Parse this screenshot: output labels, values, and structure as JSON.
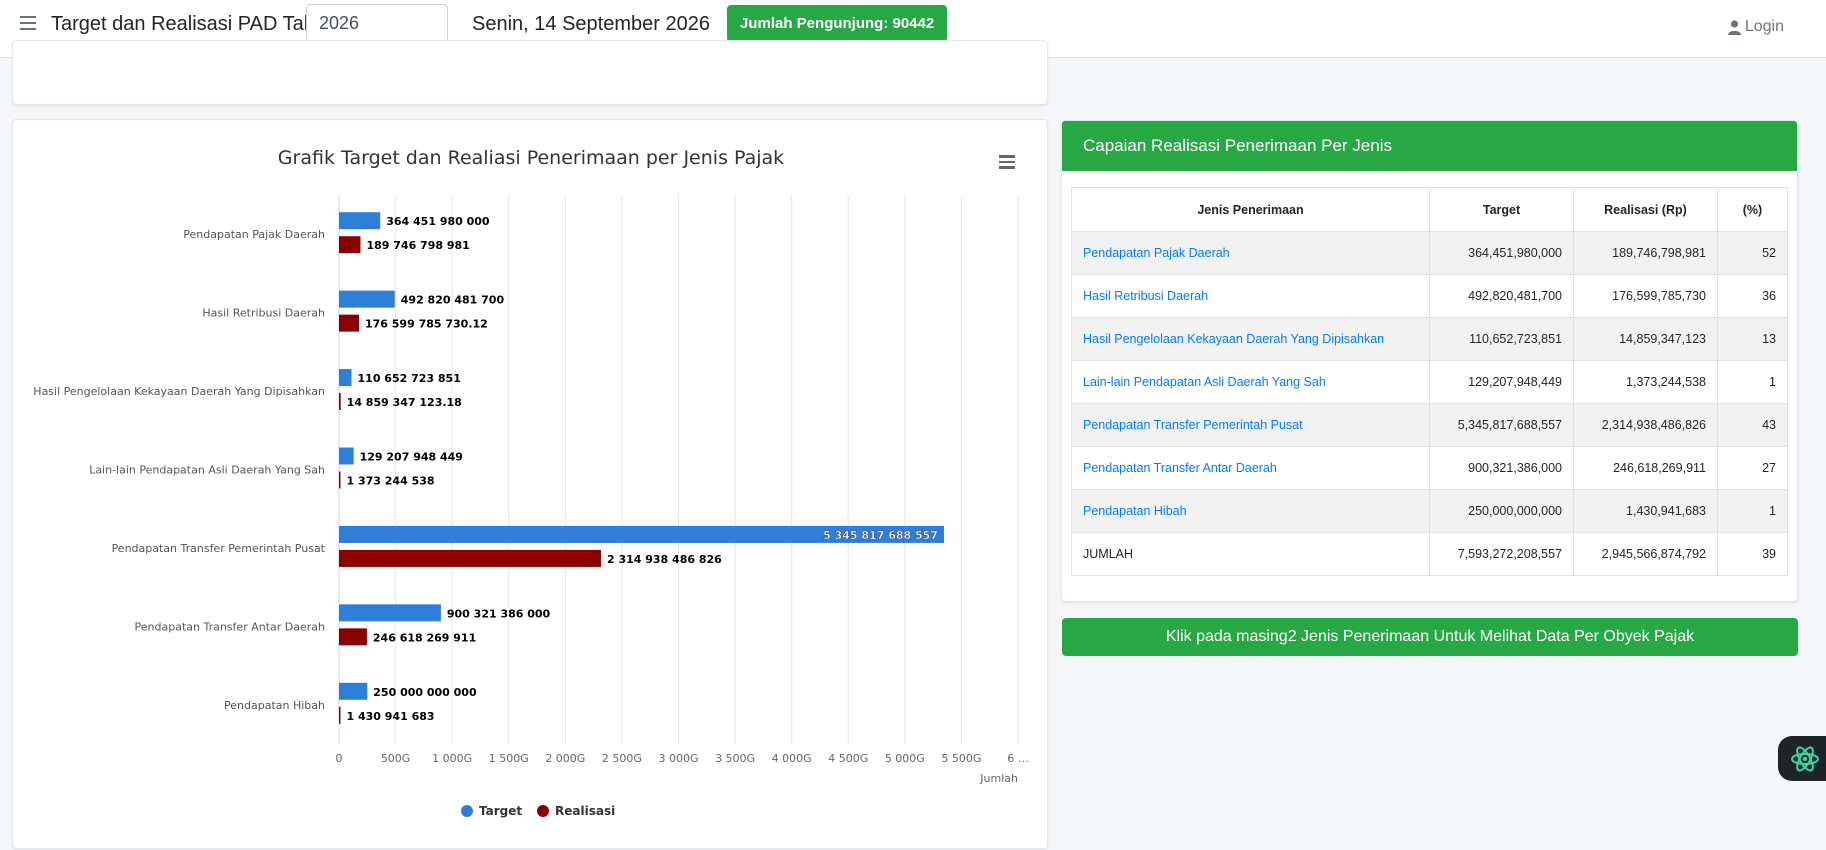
{
  "header": {
    "title": "Target dan Realisasi PAD Tahun",
    "year_value": "2026",
    "date": "Senin, 14 September 2026",
    "visitor_badge": "Jumlah Pengunjung: 90442",
    "login_label": "Login"
  },
  "colors": {
    "accent": "#28a745",
    "target": "#2f7ed8",
    "realisasi": "#8b0000",
    "link": "#007bff"
  },
  "chart_data": {
    "type": "bar",
    "orientation": "horizontal",
    "title": "Grafik Target dan Realiasi Penerimaan per Jenis Pajak",
    "ylabel": "Jumlah",
    "categories": [
      "Pendapatan Pajak Daerah",
      "Hasil Retribusi Daerah",
      "Hasil Pengelolaan Kekayaan Daerah Yang Dipisahkan",
      "Lain-lain Pendapatan Asli Daerah Yang Sah",
      "Pendapatan Transfer Pemerintah Pusat",
      "Pendapatan Transfer Antar Daerah",
      "Pendapatan Hibah"
    ],
    "series": [
      {
        "name": "Target",
        "values": [
          364451980000,
          492820481700,
          110652723851,
          129207948449,
          5345817688557,
          900321386000,
          250000000000
        ],
        "labels": [
          "364 451 980 000",
          "492 820 481 700",
          "110 652 723 851",
          "129 207 948 449",
          "5 345 817 688 557",
          "900 321 386 000",
          "250 000 000 000"
        ]
      },
      {
        "name": "Realisasi",
        "values": [
          189746798981,
          176599785730.12,
          14859347123.18,
          1373244538,
          2314938486826,
          246618269911,
          1430941683
        ],
        "labels": [
          "189 746 798 981",
          "176 599 785 730.12",
          "14 859 347 123.18",
          "1 373 244 538",
          "2 314 938 486 826",
          "246 618 269 911",
          "1 430 941 683"
        ]
      }
    ],
    "axis_ticks": [
      "0",
      "500G",
      "1 000G",
      "1 500G",
      "2 000G",
      "2 500G",
      "3 000G",
      "3 500G",
      "4 000G",
      "4 500G",
      "5 000G",
      "5 500G",
      "6 …"
    ],
    "xlim": [
      0,
      6000000000000
    ],
    "grid": true,
    "legend_position": "bottom-center"
  },
  "table": {
    "title": "Capaian Realisasi Penerimaan Per Jenis",
    "headers": [
      "Jenis Penerimaan",
      "Target",
      "Realisasi (Rp)",
      "(%)"
    ],
    "rows": [
      {
        "name": "Pendapatan Pajak Daerah",
        "target": "364,451,980,000",
        "realisasi": "189,746,798,981",
        "pct": "52"
      },
      {
        "name": "Hasil Retribusi Daerah",
        "target": "492,820,481,700",
        "realisasi": "176,599,785,730",
        "pct": "36"
      },
      {
        "name": "Hasil Pengelolaan Kekayaan Daerah Yang Dipisahkan",
        "target": "110,652,723,851",
        "realisasi": "14,859,347,123",
        "pct": "13"
      },
      {
        "name": "Lain-lain Pendapatan Asli Daerah Yang Sah",
        "target": "129,207,948,449",
        "realisasi": "1,373,244,538",
        "pct": "1"
      },
      {
        "name": "Pendapatan Transfer Pemerintah Pusat",
        "target": "5,345,817,688,557",
        "realisasi": "2,314,938,486,826",
        "pct": "43"
      },
      {
        "name": "Pendapatan Transfer Antar Daerah",
        "target": "900,321,386,000",
        "realisasi": "246,618,269,911",
        "pct": "27"
      },
      {
        "name": "Pendapatan Hibah",
        "target": "250,000,000,000",
        "realisasi": "1,430,941,683",
        "pct": "1"
      }
    ],
    "total": {
      "name": "JUMLAH",
      "target": "7,593,272,208,557",
      "realisasi": "2,945,566,874,792",
      "pct": "39"
    }
  },
  "info_button": "Klik pada masing2 Jenis Penerimaan Untuk Melihat Data Per Obyek Pajak"
}
